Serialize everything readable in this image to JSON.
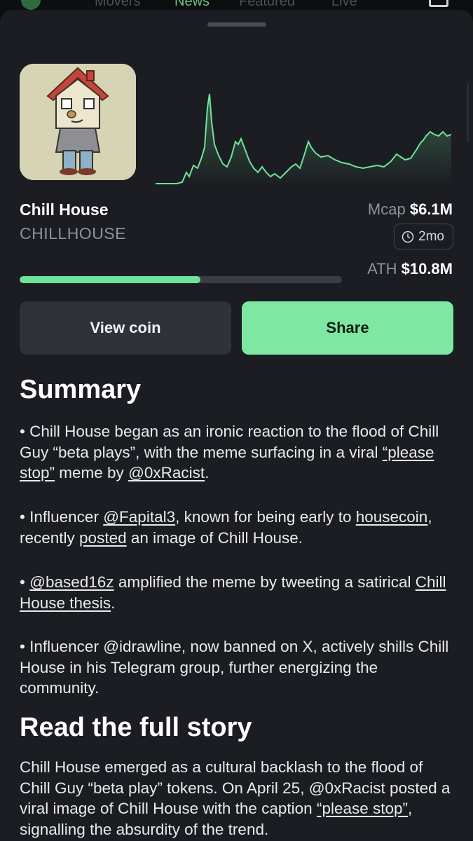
{
  "top_nav": {
    "tabs": [
      "Movers",
      "News",
      "Featured",
      "Live"
    ],
    "active": "News"
  },
  "coin": {
    "name": "Chill House",
    "ticker": "CHILLHOUSE",
    "mcap_label": "Mcap",
    "mcap_value": "$6.1M",
    "age": "2mo",
    "ath_label": "ATH",
    "ath_value": "$10.8M",
    "ath_progress": 0.56,
    "chart_color": "#6ee39a"
  },
  "buttons": {
    "view": "View coin",
    "share": "Share"
  },
  "summary": {
    "title": "Summary",
    "p1": {
      "a": "• Chill House began as an ironic reaction to the flood of Chill Guy “beta plays”, with the meme surfacing in a viral ",
      "link1": "“please stop”",
      "b": " meme by ",
      "link2": "@0xRacist",
      "c": "."
    },
    "p2": {
      "a": "• Influencer ",
      "link1": "@Fapital3",
      "b": ", known for being early to ",
      "link2": "housecoin",
      "c": ", recently ",
      "link3": "posted",
      "d": " an image of Chill House."
    },
    "p3": {
      "a": "• ",
      "link1": "@based16z",
      "b": " amplified the meme by tweeting a satirical ",
      "link2": "Chill House thesis",
      "c": "."
    },
    "p4": "• Influencer @idrawline, now banned on X, actively shills Chill House in his Telegram group, further energizing the community."
  },
  "story": {
    "title": "Read the full story",
    "a": "Chill House emerged as a cultural backlash to the flood of Chill Guy “beta play” tokens. On April 25, @0xRacist posted a viral image of Chill House with the caption ",
    "link1": "“please stop”",
    "b": ", signalling the absurdity of the trend."
  }
}
